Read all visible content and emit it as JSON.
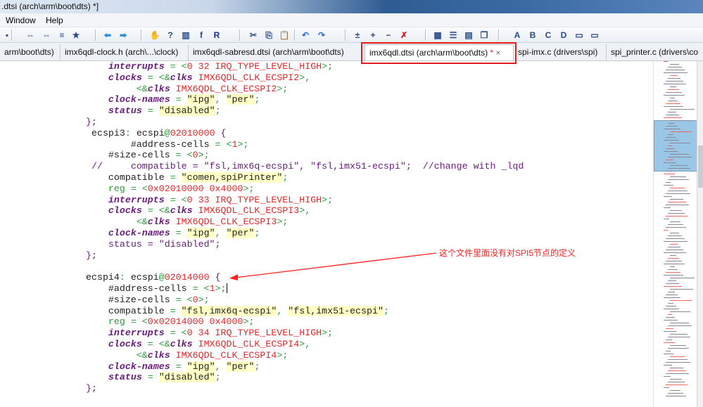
{
  "window": {
    "title": ".dtsi (arch\\arm\\boot\\dts) *]"
  },
  "menu": {
    "items": [
      "Window",
      "Help"
    ]
  },
  "toolbar": {
    "icons": [
      "bookmark-prev-icon",
      "bookmark-next-icon",
      "indent-icon",
      "favorite-icon",
      "back-arrow-icon",
      "forward-arrow-icon",
      "hand-icon",
      "help-icon",
      "book-icon",
      "function-icon",
      "r-icon",
      "cut-icon",
      "copy-icon",
      "paste-icon",
      "undo-icon",
      "redo-icon",
      "plus-minus-icon",
      "expand-icon",
      "collapse-icon",
      "close-x-icon",
      "grid-icon",
      "list-icon",
      "split-icon",
      "windows-icon",
      "a-icon",
      "b-icon",
      "c-icon",
      "d-icon",
      "folder-icon",
      "new-folder-icon"
    ]
  },
  "tabs": [
    {
      "label": "arm\\boot\\dts)"
    },
    {
      "label": "imx6qdl-clock.h (arch\\...\\clock)"
    },
    {
      "label": "imx6qdl-sabresd.dtsi (arch\\arm\\boot\\dts)"
    },
    {
      "label": "imx6qdl.dtsi (arch\\arm\\boot\\dts)",
      "modified": "*",
      "close": "×",
      "active": true
    },
    {
      "label": "spi-imx.c (drivers\\spi)"
    },
    {
      "label": "spi_printer.c (drivers\\co"
    }
  ],
  "annotation": "这个文件里面没有对SPI5节点的定义",
  "code": [
    [
      [
        "p",
        "    "
      ],
      [
        "k",
        "interrupts"
      ],
      [
        "g",
        " = <"
      ],
      [
        "r",
        "0 32 IRQ_TYPE_LEVEL_HIGH"
      ],
      [
        "g",
        ">;"
      ]
    ],
    [
      [
        "p",
        "    "
      ],
      [
        "k",
        "clocks"
      ],
      [
        "g",
        " = <&"
      ],
      [
        "k",
        "clks"
      ],
      [
        "r",
        " IMX6QDL_CLK_ECSPI2"
      ],
      [
        "g",
        ">,"
      ]
    ],
    [
      [
        "p",
        "         "
      ],
      [
        "g",
        "<&"
      ],
      [
        "k",
        "clks"
      ],
      [
        "r",
        " IMX6QDL_CLK_ECSPI2"
      ],
      [
        "g",
        ">;"
      ]
    ],
    [
      [
        "p",
        "    "
      ],
      [
        "k",
        "clock-names"
      ],
      [
        "g",
        " = "
      ],
      [
        "s",
        "\"ipg\""
      ],
      [
        "g",
        ", "
      ],
      [
        "s",
        "\"per\""
      ],
      [
        "g",
        ";"
      ]
    ],
    [
      [
        "p",
        "    "
      ],
      [
        "k",
        "status"
      ],
      [
        "g",
        " = "
      ],
      [
        "s",
        "\"disabled\""
      ],
      [
        "g",
        ";"
      ]
    ],
    [
      [
        "c",
        "};"
      ]
    ],
    [
      [
        "p",
        " ecspi3"
      ],
      [
        "g",
        ": "
      ],
      [
        "p",
        "ecspi"
      ],
      [
        "g",
        "@"
      ],
      [
        "r",
        "02010000"
      ],
      [
        "c",
        " {"
      ]
    ],
    [
      [
        "p",
        "        #address-cells"
      ],
      [
        "g",
        " = <"
      ],
      [
        "r",
        "1"
      ],
      [
        "g",
        ">;"
      ]
    ],
    [
      [
        "p",
        "    #size-cells"
      ],
      [
        "g",
        " = <"
      ],
      [
        "r",
        "0"
      ],
      [
        "g",
        ">;"
      ]
    ],
    [
      [
        "pu",
        " //     compatible = \"fsl,imx6q-ecspi\", \"fsl,imx51-ecspi\";  //change with _lqd"
      ]
    ],
    [
      [
        "p",
        "    compatible"
      ],
      [
        "g",
        " = "
      ],
      [
        "s",
        "\"comen,spiPrinter\""
      ],
      [
        "g",
        ";"
      ]
    ],
    [
      [
        "g",
        "    reg = <"
      ],
      [
        "r",
        "0x02010000 0x4000"
      ],
      [
        "g",
        ">;"
      ]
    ],
    [
      [
        "p",
        "    "
      ],
      [
        "k",
        "interrupts"
      ],
      [
        "g",
        " = <"
      ],
      [
        "r",
        "0 33 IRQ_TYPE_LEVEL_HIGH"
      ],
      [
        "g",
        ">;"
      ]
    ],
    [
      [
        "p",
        "    "
      ],
      [
        "k",
        "clocks"
      ],
      [
        "g",
        " = <&"
      ],
      [
        "k",
        "clks"
      ],
      [
        "r",
        " IMX6QDL_CLK_ECSPI3"
      ],
      [
        "g",
        ">,"
      ]
    ],
    [
      [
        "p",
        "         "
      ],
      [
        "g",
        "<&"
      ],
      [
        "k",
        "clks"
      ],
      [
        "r",
        " IMX6QDL_CLK_ECSPI3"
      ],
      [
        "g",
        ">;"
      ]
    ],
    [
      [
        "p",
        "    "
      ],
      [
        "k",
        "clock-names"
      ],
      [
        "g",
        " = "
      ],
      [
        "s",
        "\"ipg\""
      ],
      [
        "g",
        ", "
      ],
      [
        "s",
        "\"per\""
      ],
      [
        "g",
        ";"
      ]
    ],
    [
      [
        "pu",
        "    status = \"disabled\";"
      ]
    ],
    [
      [
        "c",
        "};"
      ]
    ],
    [
      [
        "p",
        ""
      ]
    ],
    [
      [
        "p",
        "ecspi4"
      ],
      [
        "g",
        ": "
      ],
      [
        "p",
        "ecspi"
      ],
      [
        "g",
        "@"
      ],
      [
        "r",
        "02014000"
      ],
      [
        "c",
        " {"
      ]
    ],
    [
      [
        "p",
        "    #address-cells"
      ],
      [
        "g",
        " = <"
      ],
      [
        "r",
        "1"
      ],
      [
        "g",
        ">;"
      ]
    ],
    [
      [
        "p",
        "    #size-cells"
      ],
      [
        "g",
        " = <"
      ],
      [
        "r",
        "0"
      ],
      [
        "g",
        ">;"
      ]
    ],
    [
      [
        "p",
        "    compatible"
      ],
      [
        "g",
        " = "
      ],
      [
        "s",
        "\"fsl,imx6q-ecspi\""
      ],
      [
        "g",
        ", "
      ],
      [
        "s",
        "\"fsl,imx51-ecspi\""
      ],
      [
        "g",
        ";"
      ]
    ],
    [
      [
        "g",
        "    reg = <"
      ],
      [
        "r",
        "0x02014000 0x4000"
      ],
      [
        "g",
        ">;"
      ]
    ],
    [
      [
        "p",
        "    "
      ],
      [
        "k",
        "interrupts"
      ],
      [
        "g",
        " = <"
      ],
      [
        "r",
        "0 34 IRQ_TYPE_LEVEL_HIGH"
      ],
      [
        "g",
        ">;"
      ]
    ],
    [
      [
        "p",
        "    "
      ],
      [
        "k",
        "clocks"
      ],
      [
        "g",
        " = <&"
      ],
      [
        "k",
        "clks"
      ],
      [
        "r",
        " IMX6QDL_CLK_ECSPI4"
      ],
      [
        "g",
        ">,"
      ]
    ],
    [
      [
        "p",
        "         "
      ],
      [
        "g",
        "<&"
      ],
      [
        "k",
        "clks"
      ],
      [
        "r",
        " IMX6QDL_CLK_ECSPI4"
      ],
      [
        "g",
        ">;"
      ]
    ],
    [
      [
        "p",
        "    "
      ],
      [
        "k",
        "clock-names"
      ],
      [
        "g",
        " = "
      ],
      [
        "s",
        "\"ipg\""
      ],
      [
        "g",
        ", "
      ],
      [
        "s",
        "\"per\""
      ],
      [
        "g",
        ";"
      ]
    ],
    [
      [
        "p",
        "    "
      ],
      [
        "k",
        "status"
      ],
      [
        "g",
        " = "
      ],
      [
        "s",
        "\"disabled\""
      ],
      [
        "g",
        ";"
      ]
    ],
    [
      [
        "c",
        "};"
      ]
    ]
  ]
}
